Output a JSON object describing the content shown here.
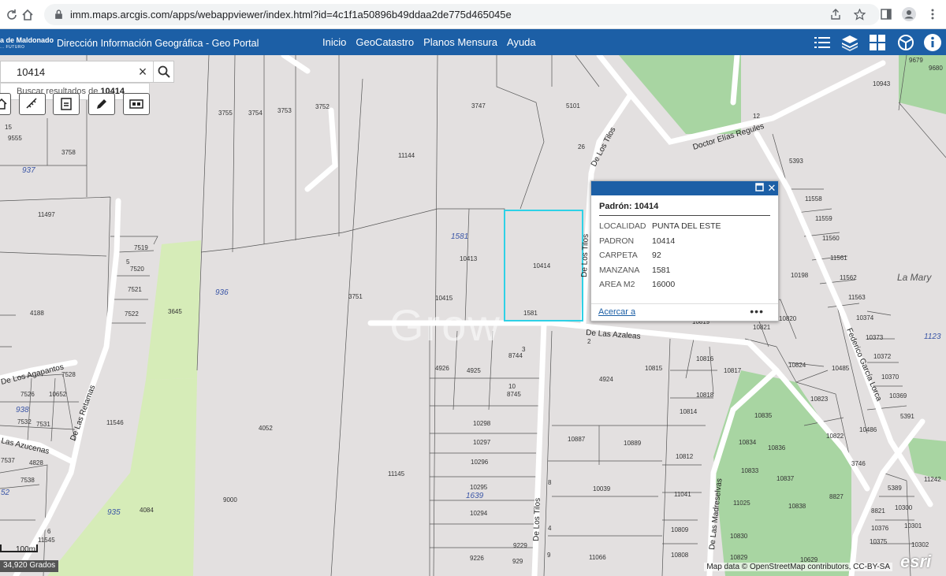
{
  "browser": {
    "url": "imm.maps.arcgis.com/apps/webappviewer/index.html?id=4c1f1a50896b49ddaa2de775d465045e"
  },
  "header": {
    "brand_name": "a de Maldonado",
    "brand_tagline": "... FUTURO",
    "app_title": "Dirección Información Geográfica -  Geo Portal",
    "nav": [
      "Inicio",
      "GeoCatastro",
      "Planos Mensura",
      "Ayuda"
    ],
    "tools": [
      "list-icon",
      "layers-icon",
      "grid-icon",
      "basemap-icon",
      "info-icon"
    ]
  },
  "search": {
    "value": "10414",
    "suggestion_prefix": "Buscar resultados de ",
    "suggestion_term": "10414"
  },
  "popup": {
    "title": "Padrón: 10414",
    "attributes": [
      {
        "key": "LOCALIDAD",
        "value": "PUNTA DEL ESTE"
      },
      {
        "key": "PADRON",
        "value": "10414"
      },
      {
        "key": "CARPETA",
        "value": "92"
      },
      {
        "key": "MANZANA",
        "value": "1581"
      },
      {
        "key": "AREA M2",
        "value": "16000"
      }
    ],
    "zoom_link": "Acercar a",
    "more": "•••"
  },
  "map": {
    "parcel_labels": [
      "9555",
      "3758",
      "11497",
      "7519",
      "7520",
      "7521",
      "7522",
      "3645",
      "4188",
      "7528",
      "7526",
      "10652",
      "7532",
      "7531",
      "11546",
      "4052",
      "9000",
      "3755",
      "3754",
      "3753",
      "3752",
      "3747",
      "5101",
      "11144",
      "10413",
      "10414",
      "10415",
      "1581",
      "3751",
      "4926",
      "4925",
      "8744",
      "8745",
      "10298",
      "10297",
      "10296",
      "10295",
      "10294",
      "11145",
      "9229",
      "9226",
      "929",
      "4924",
      "10887",
      "10889",
      "10039",
      "10812",
      "11041",
      "10809",
      "10808",
      "11066",
      "10815",
      "10816",
      "10817",
      "10818",
      "10814",
      "10819",
      "10821",
      "10820",
      "10198",
      "10824",
      "10823",
      "10822",
      "10485",
      "10486",
      "3746",
      "10835",
      "10834",
      "10836",
      "10833",
      "10837",
      "10838",
      "11025",
      "10830",
      "10829",
      "10629",
      "8827",
      "5393",
      "11558",
      "11559",
      "11560",
      "11561",
      "11562",
      "11563",
      "10374",
      "10373",
      "10372",
      "10370",
      "10369",
      "5391",
      "5389",
      "10300",
      "10301",
      "10302",
      "10376",
      "10375",
      "8821",
      "11242",
      "10943",
      "9679",
      "9680",
      "4084",
      "11545",
      "4828",
      "7537",
      "7538",
      "12",
      "26",
      "15",
      "3",
      "10",
      "2",
      "8",
      "4",
      "9",
      "5",
      "6"
    ],
    "block_labels": [
      "937",
      "936",
      "938",
      "1581",
      "1639",
      "935",
      "52",
      "1123"
    ],
    "streets": [
      "Doctor Elías Regules",
      "De Los Tilos",
      "De Las Azaleas",
      "De Los Agapantos",
      "De Las Retamas",
      "Las Azucenas",
      "Federico García Lorca",
      "De Las Madreselvas",
      "De Los Tilos"
    ],
    "place_label": "La Mary",
    "watermark": "Grow",
    "street_label_9": "De Los Tilos"
  },
  "footer": {
    "scale_label": "100m",
    "scale_text": "34,920 Grados",
    "attribution": "Map data © OpenStreetMap contributors, CC-BY-SA",
    "esri": "esri"
  }
}
